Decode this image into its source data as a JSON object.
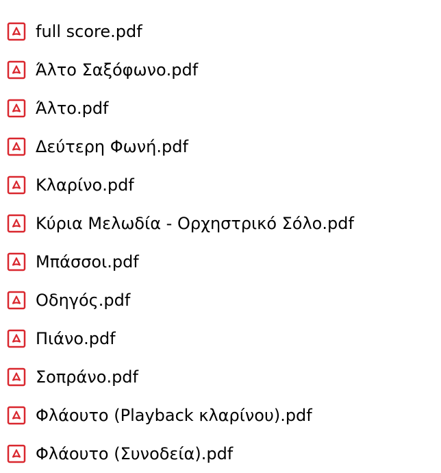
{
  "file_list": {
    "items": [
      {
        "name": "full score.pdf",
        "icon": "pdf-file-icon"
      },
      {
        "name": "Άλτο Σαξόφωνο.pdf",
        "icon": "pdf-file-icon"
      },
      {
        "name": "Άλτο.pdf",
        "icon": "pdf-file-icon"
      },
      {
        "name": "Δεύτερη Φωνή.pdf",
        "icon": "pdf-file-icon"
      },
      {
        "name": "Κλαρίνο.pdf",
        "icon": "pdf-file-icon"
      },
      {
        "name": "Κύρια Μελωδία - Ορχηστρικό Σόλο.pdf",
        "icon": "pdf-file-icon"
      },
      {
        "name": "Μπάσσοι.pdf",
        "icon": "pdf-file-icon"
      },
      {
        "name": "Οδηγός.pdf",
        "icon": "pdf-file-icon"
      },
      {
        "name": "Πιάνο.pdf",
        "icon": "pdf-file-icon"
      },
      {
        "name": "Σοπράνο.pdf",
        "icon": "pdf-file-icon"
      },
      {
        "name": "Φλάουτο (Playback κλαρίνου).pdf",
        "icon": "pdf-file-icon"
      },
      {
        "name": "Φλάουτο (Συνοδεία).pdf",
        "icon": "pdf-file-icon"
      }
    ]
  },
  "colors": {
    "icon_red": "#d9272e",
    "icon_fill": "#ffffff",
    "text": "#000000"
  }
}
